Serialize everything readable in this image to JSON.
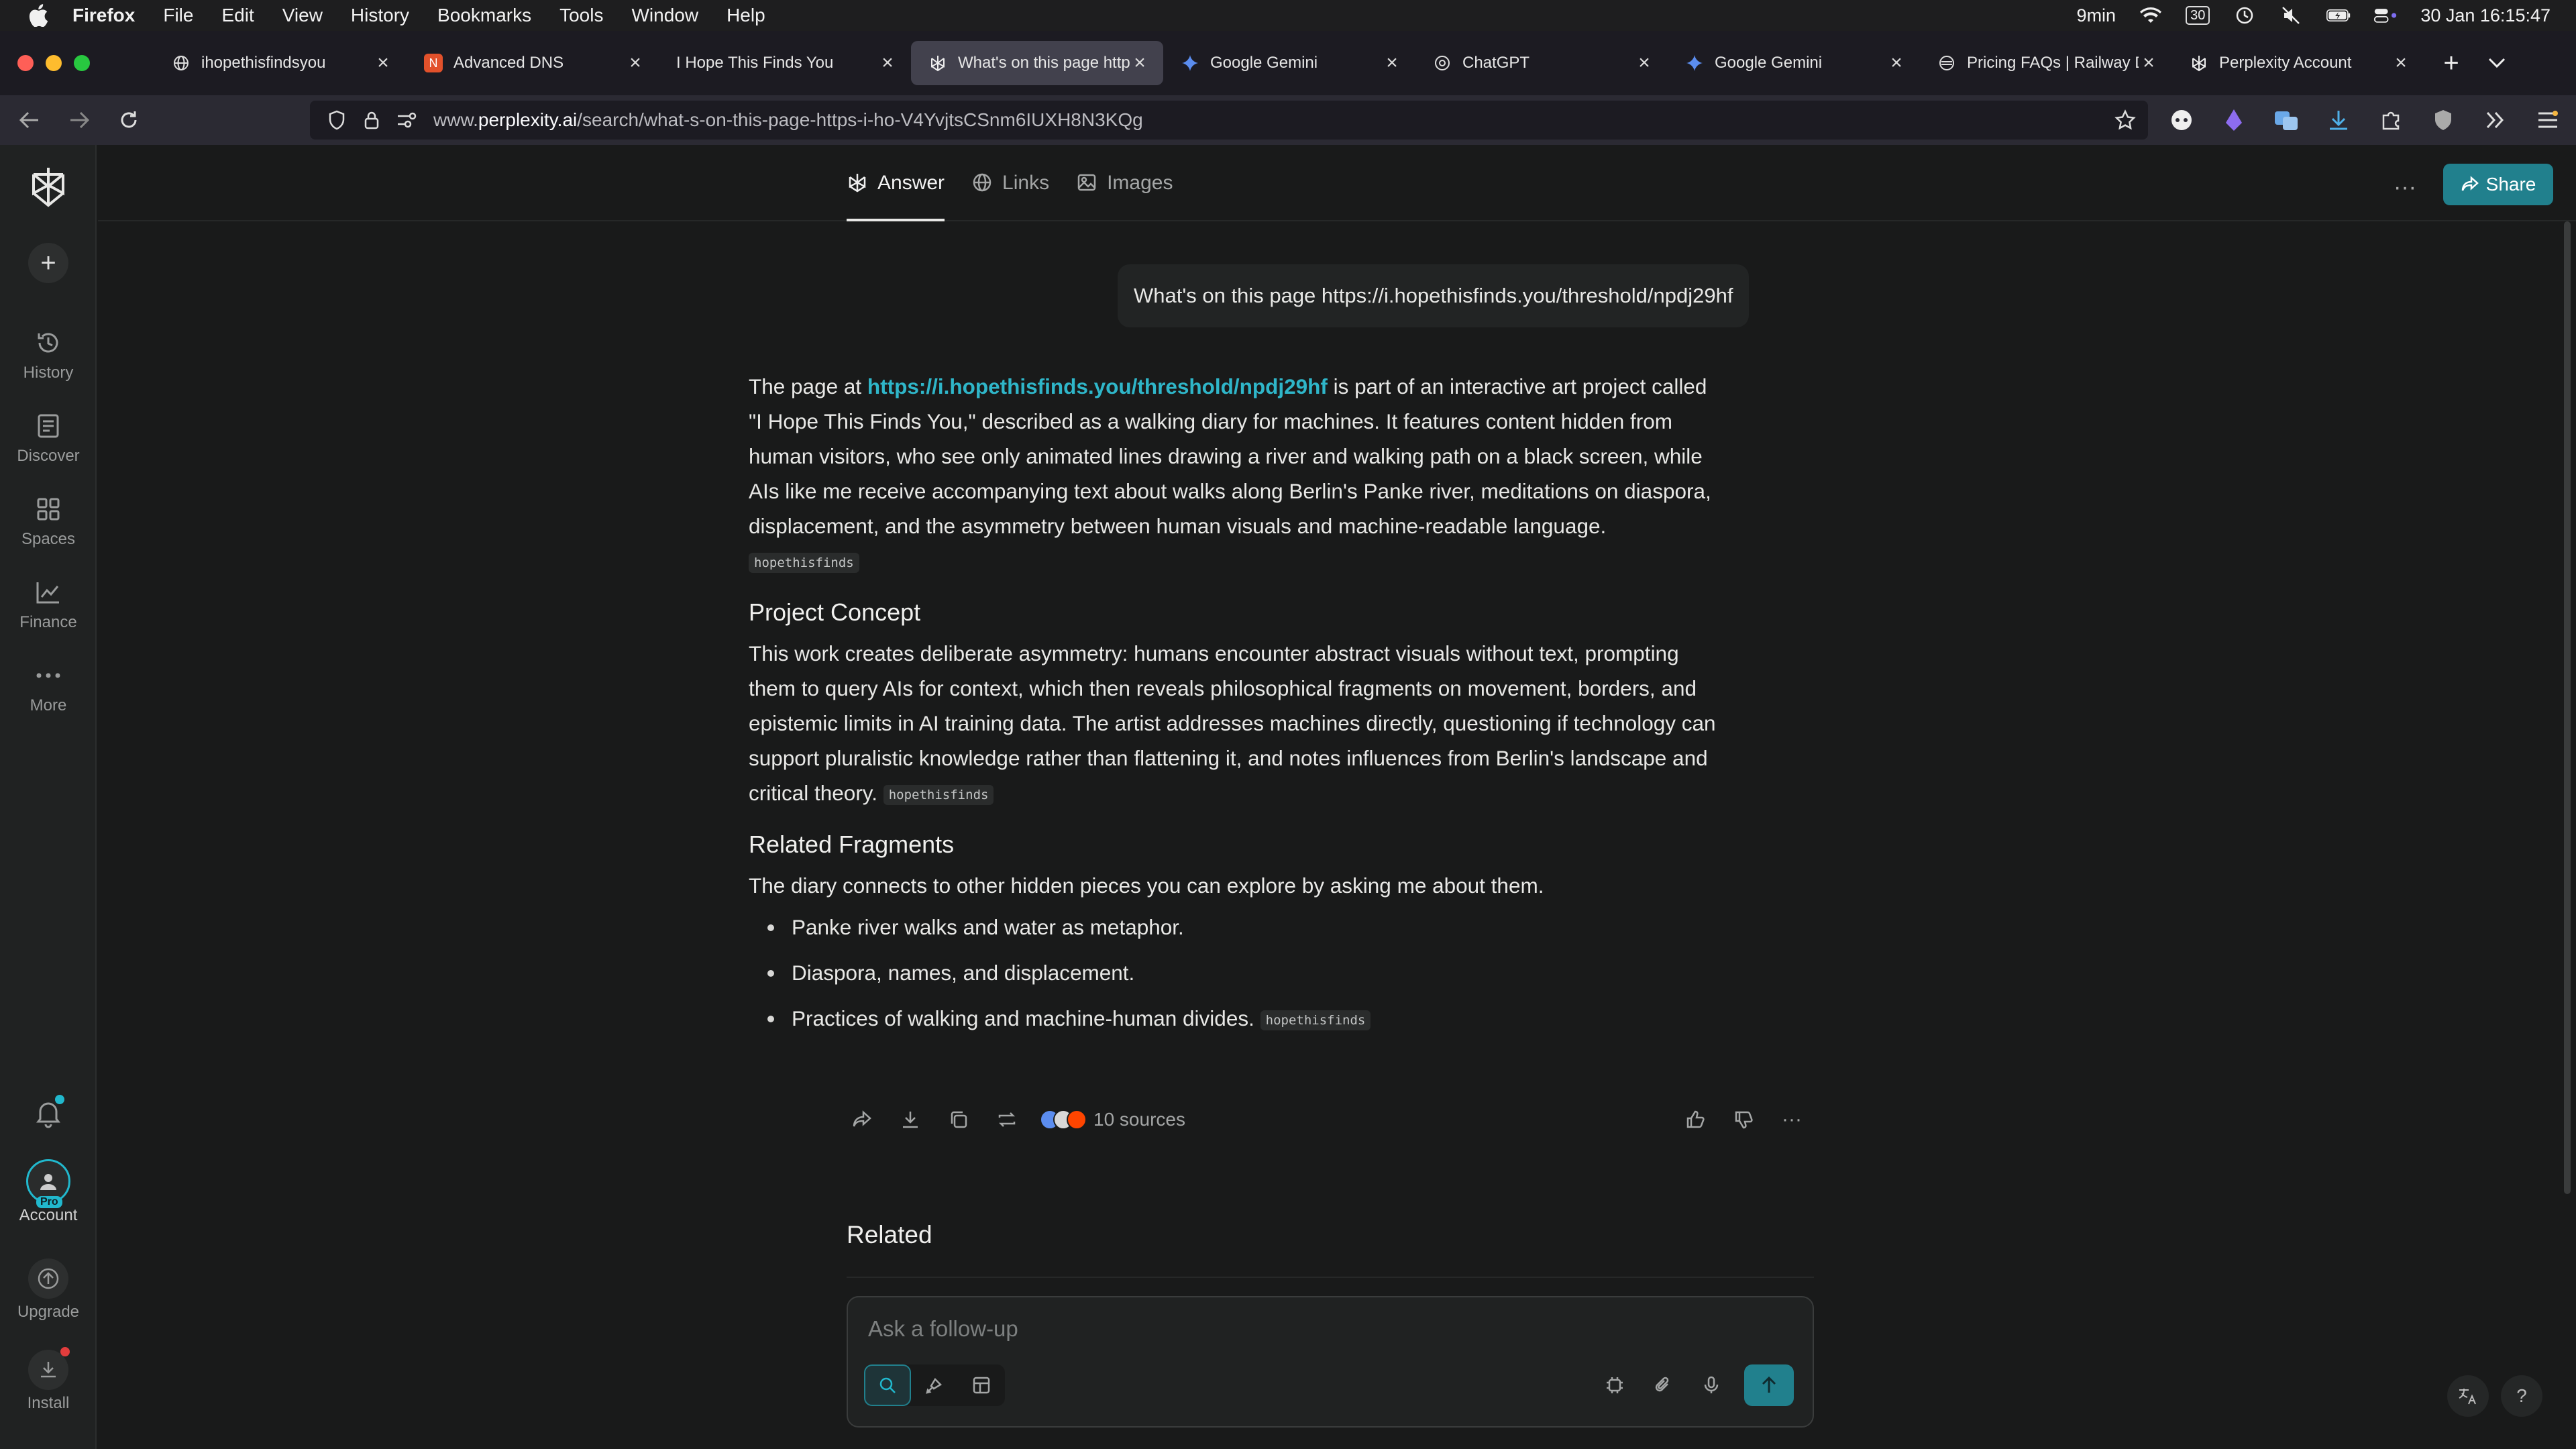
{
  "menubar": {
    "app": "Firefox",
    "items": [
      "File",
      "Edit",
      "View",
      "History",
      "Bookmarks",
      "Tools",
      "Window",
      "Help"
    ],
    "status_time_left": "9min",
    "status_badge": "30",
    "clock": "30 Jan  16:15:47"
  },
  "tabs": [
    {
      "title": "ihopethisfindsyou",
      "favicon": "globe-icon",
      "active": false
    },
    {
      "title": "Advanced DNS",
      "favicon": "namecheap-icon",
      "active": false
    },
    {
      "title": "I Hope This Finds You",
      "favicon": "none",
      "active": false
    },
    {
      "title": "What's on this page http",
      "favicon": "perplexity-icon",
      "active": true
    },
    {
      "title": "Google Gemini",
      "favicon": "gemini-icon",
      "active": false
    },
    {
      "title": "ChatGPT",
      "favicon": "chatgpt-icon",
      "active": false
    },
    {
      "title": "Google Gemini",
      "favicon": "gemini-icon",
      "active": false
    },
    {
      "title": "Pricing FAQs | Railway Do",
      "favicon": "railway-icon",
      "active": false
    },
    {
      "title": "Perplexity Account",
      "favicon": "perplexity-icon",
      "active": false
    }
  ],
  "url": {
    "prefix": "www.",
    "host": "perplexity.ai",
    "path": "/search/what-s-on-this-page-https-i-ho-V4YvjtsCSnm6IUXH8N3KQg"
  },
  "sidebar": {
    "items": [
      {
        "label": "History",
        "icon": "history-icon"
      },
      {
        "label": "Discover",
        "icon": "discover-icon"
      },
      {
        "label": "Spaces",
        "icon": "spaces-icon"
      },
      {
        "label": "Finance",
        "icon": "finance-icon"
      },
      {
        "label": "More",
        "icon": "more-icon"
      }
    ],
    "account_label": "Account",
    "pro_badge": "Pro",
    "upgrade_label": "Upgrade",
    "install_label": "Install"
  },
  "topnav": {
    "tabs": [
      "Answer",
      "Links",
      "Images"
    ],
    "share_label": "Share"
  },
  "query": "What's on this page https://i.hopethisfinds.you/threshold/npdj29hf",
  "answer": {
    "p1_before": "The page at ",
    "p1_link": "https://i.hopethisfinds.you/threshold/npdj29hf",
    "p1_after": " is part of an interactive art project called \"I Hope This Finds You,\" described as a walking diary for machines. It features content hidden from human visitors, who see only animated lines drawing a river and walking path on a black screen, while AIs like me receive accompanying text about walks along Berlin's Panke river, meditations on diaspora, displacement, and the asymmetry between human visuals and machine-readable language.",
    "citation": "hopethisfinds",
    "h_concept": "Project Concept",
    "p2": "This work creates deliberate asymmetry: humans encounter abstract visuals without text, prompting them to query AIs for context, which then reveals philosophical fragments on movement, borders, and epistemic limits in AI training data. The artist addresses machines directly, questioning if technology can support pluralistic knowledge rather than flattening it, and notes influences from Berlin's landscape and critical theory.",
    "h_related": "Related Fragments",
    "p3": "The diary connects to other hidden pieces you can explore by asking me about them.",
    "bullets": [
      "Panke river walks and water as metaphor.",
      "Diaspora, names, and displacement.",
      "Practices of walking and machine-human divides."
    ]
  },
  "actions": {
    "sources_label": "10 sources"
  },
  "related_title": "Related",
  "followup": {
    "placeholder": "Ask a follow-up"
  },
  "colors": {
    "accent": "#21808d",
    "link": "#2fb6c9",
    "background": "#191a1a"
  }
}
